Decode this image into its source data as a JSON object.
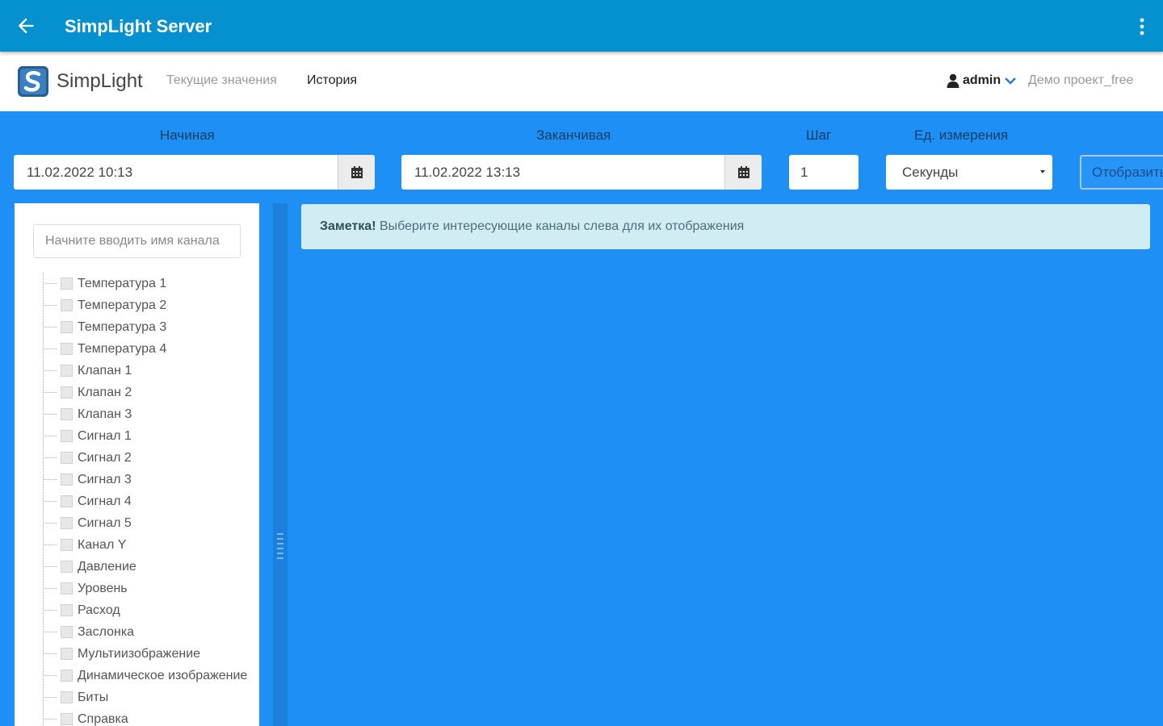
{
  "appbar": {
    "title": "SimpLight Server",
    "back_icon": "arrow-left-icon",
    "menu_icon": "more-vert-icon"
  },
  "nav": {
    "brand": "SimpLight",
    "links": {
      "current": "Текущие значения",
      "history": "История"
    },
    "user": "admin",
    "project": "Демо проект_free"
  },
  "filters": {
    "start_label": "Начиная",
    "start_value": "11.02.2022 10:13",
    "end_label": "Заканчивая",
    "end_value": "11.02.2022 13:13",
    "step_label": "Шаг",
    "step_value": "1",
    "unit_label": "Ед. измерения",
    "unit_value": "Секунды",
    "show_button": "Отобразить"
  },
  "sidebar": {
    "search_placeholder": "Начните вводить имя канала",
    "channels": [
      "Температура 1",
      "Температура 2",
      "Температура 3",
      "Температура 4",
      "Клапан 1",
      "Клапан 2",
      "Клапан 3",
      "Сигнал 1",
      "Сигнал 2",
      "Сигнал 3",
      "Сигнал 4",
      "Сигнал 5",
      "Канал Y",
      "Давление",
      "Уровень",
      "Расход",
      "Заслонка",
      "Мультиизображение",
      "Динамическое изображение",
      "Биты",
      "Справка"
    ]
  },
  "alert": {
    "strong": "Заметка!",
    "text": " Выберите интересующие каналы слева для их отображения"
  },
  "colors": {
    "appbar": "#0590d0",
    "background": "#1e8ff5",
    "alert_bg": "#d2ecf3"
  }
}
